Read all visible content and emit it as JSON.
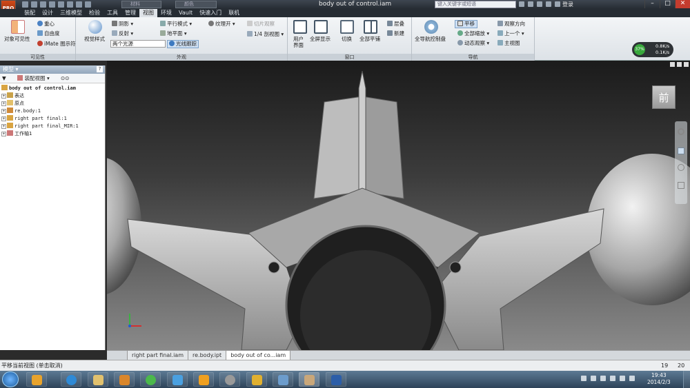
{
  "title_bar": {
    "app_logo": "PRO",
    "material_combo": "材料",
    "appearance_combo": "颜色",
    "document_title": "body out of control.iam",
    "help_search_placeholder": "键入关键字或短语",
    "login": "登录"
  },
  "ribbon_tabs": [
    "装配",
    "设计",
    "三维模型",
    "检验",
    "工具",
    "管理",
    "视图",
    "环境",
    "Vault",
    "快速入门",
    "联机"
  ],
  "active_tab": "视图",
  "ribbon": {
    "visibility": {
      "label": "可见性",
      "object_visibility": "对象可见性",
      "center_of_gravity": "重心",
      "dof": "自由度",
      "imate": "iMate 图示符"
    },
    "appearance": {
      "label": "外观",
      "visual_style": "视觉样式",
      "shadows": "阴影",
      "reflection": "反射",
      "lighting": "两个光源",
      "parallel_mode": "平行模式",
      "ground_plane": "地平面",
      "ray_tracing": "光线跟踪",
      "texture_on": "纹理开",
      "half_section": "切片观察",
      "quarter_section": "1/4 剖视图"
    },
    "window": {
      "label": "窗口",
      "user_interface": "用户\n界面",
      "full_screen": "全屏显示",
      "switch": "切换",
      "tile_all": "全部平铺",
      "cascade": "层叠",
      "new": "新建"
    },
    "navigate": {
      "label": "导航",
      "full_nav_wheel": "全导航控制盘",
      "pan": "平移",
      "zoom_all": "全部缩放",
      "orbit": "动态观察",
      "look_at": "观察方向",
      "previous": "上一个",
      "home_view": "主视图"
    }
  },
  "status_widget": {
    "percent": "37%",
    "upload": "0.8K/s",
    "download": "0.1K/s"
  },
  "browser": {
    "title": "模型",
    "view_selector": "装配视图",
    "tree": [
      {
        "label": "body out of control.iam",
        "level": 0
      },
      {
        "label": "表达",
        "level": 1
      },
      {
        "label": "原点",
        "level": 1
      },
      {
        "label": "re.body:1",
        "level": 1
      },
      {
        "label": "right part final:1",
        "level": 1
      },
      {
        "label": "right part final_MIR:1",
        "level": 1
      },
      {
        "label": "工作轴1",
        "level": 1
      }
    ]
  },
  "viewport": {
    "viewcube_face": "前"
  },
  "doc_tabs": [
    {
      "label": "right part final.iam",
      "active": false
    },
    {
      "label": "re.body.ipt",
      "active": false
    },
    {
      "label": "body out of co...iam",
      "active": true
    }
  ],
  "status_bar": {
    "message": "平移当前视图 (单击取消)",
    "count1": "19",
    "count2": "20"
  },
  "taskbar": {
    "time": "19:43",
    "date": "2014/2/3"
  },
  "colors": {
    "accent": "#3d7ac1",
    "viewport_bg": "#5a5a5a",
    "active_tab": "#dfe3e8"
  }
}
